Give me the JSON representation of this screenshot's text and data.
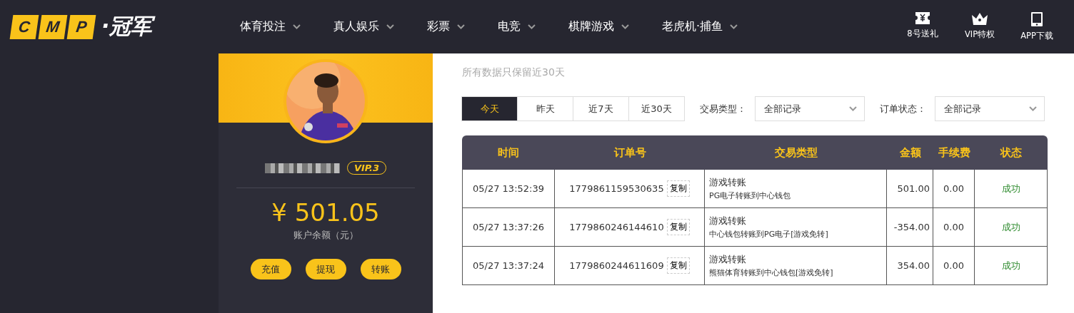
{
  "logo": {
    "letters": [
      "C",
      "M",
      "P"
    ],
    "text": "·冠军"
  },
  "nav": [
    {
      "label": "体育投注"
    },
    {
      "label": "真人娱乐"
    },
    {
      "label": "彩票"
    },
    {
      "label": "电竞"
    },
    {
      "label": "棋牌游戏"
    },
    {
      "label": "老虎机·捕鱼"
    }
  ],
  "quick_links": [
    {
      "kind": "ticket",
      "label": "8号送礼"
    },
    {
      "kind": "crown",
      "label": "VIP特权"
    },
    {
      "kind": "tablet",
      "label": "APP下载"
    }
  ],
  "profile": {
    "vip": "VIP.3",
    "balance": "¥ 501.05",
    "balance_label": "账户余额（元）",
    "actions": [
      "充值",
      "提现",
      "转账"
    ]
  },
  "subtitle": "所有数据只保留近30天",
  "ranges": [
    {
      "label": "今天",
      "selected": true
    },
    {
      "label": "昨天",
      "selected": false
    },
    {
      "label": "近7天",
      "selected": false
    },
    {
      "label": "近30天",
      "selected": false
    }
  ],
  "filters": [
    {
      "label": "交易类型：",
      "value": "全部记录"
    },
    {
      "label": "订单状态：",
      "value": "全部记录"
    }
  ],
  "table": {
    "columns": [
      "时间",
      "订单号",
      "交易类型",
      "金额",
      "手续费",
      "状态"
    ],
    "rows": [
      {
        "time": "05/27 13:52:39",
        "order": "1779861159530635",
        "copy_label": "复制",
        "type": "游戏转账",
        "detail": "PG电子转账到中心钱包",
        "amount": "501.00",
        "fee": "0.00",
        "status": "成功"
      },
      {
        "time": "05/27 13:37:26",
        "order": "1779860246144610",
        "copy_label": "复制",
        "type": "游戏转账",
        "detail": "中心钱包转账到PG电子[游戏免转]",
        "amount": "-354.00",
        "fee": "0.00",
        "status": "成功"
      },
      {
        "time": "05/27 13:37:24",
        "order": "1779860244611609",
        "copy_label": "复制",
        "type": "游戏转账",
        "detail": "熊猫体育转账到中心钱包[游戏免转]",
        "amount": "354.00",
        "fee": "0.00",
        "status": "成功"
      }
    ]
  }
}
